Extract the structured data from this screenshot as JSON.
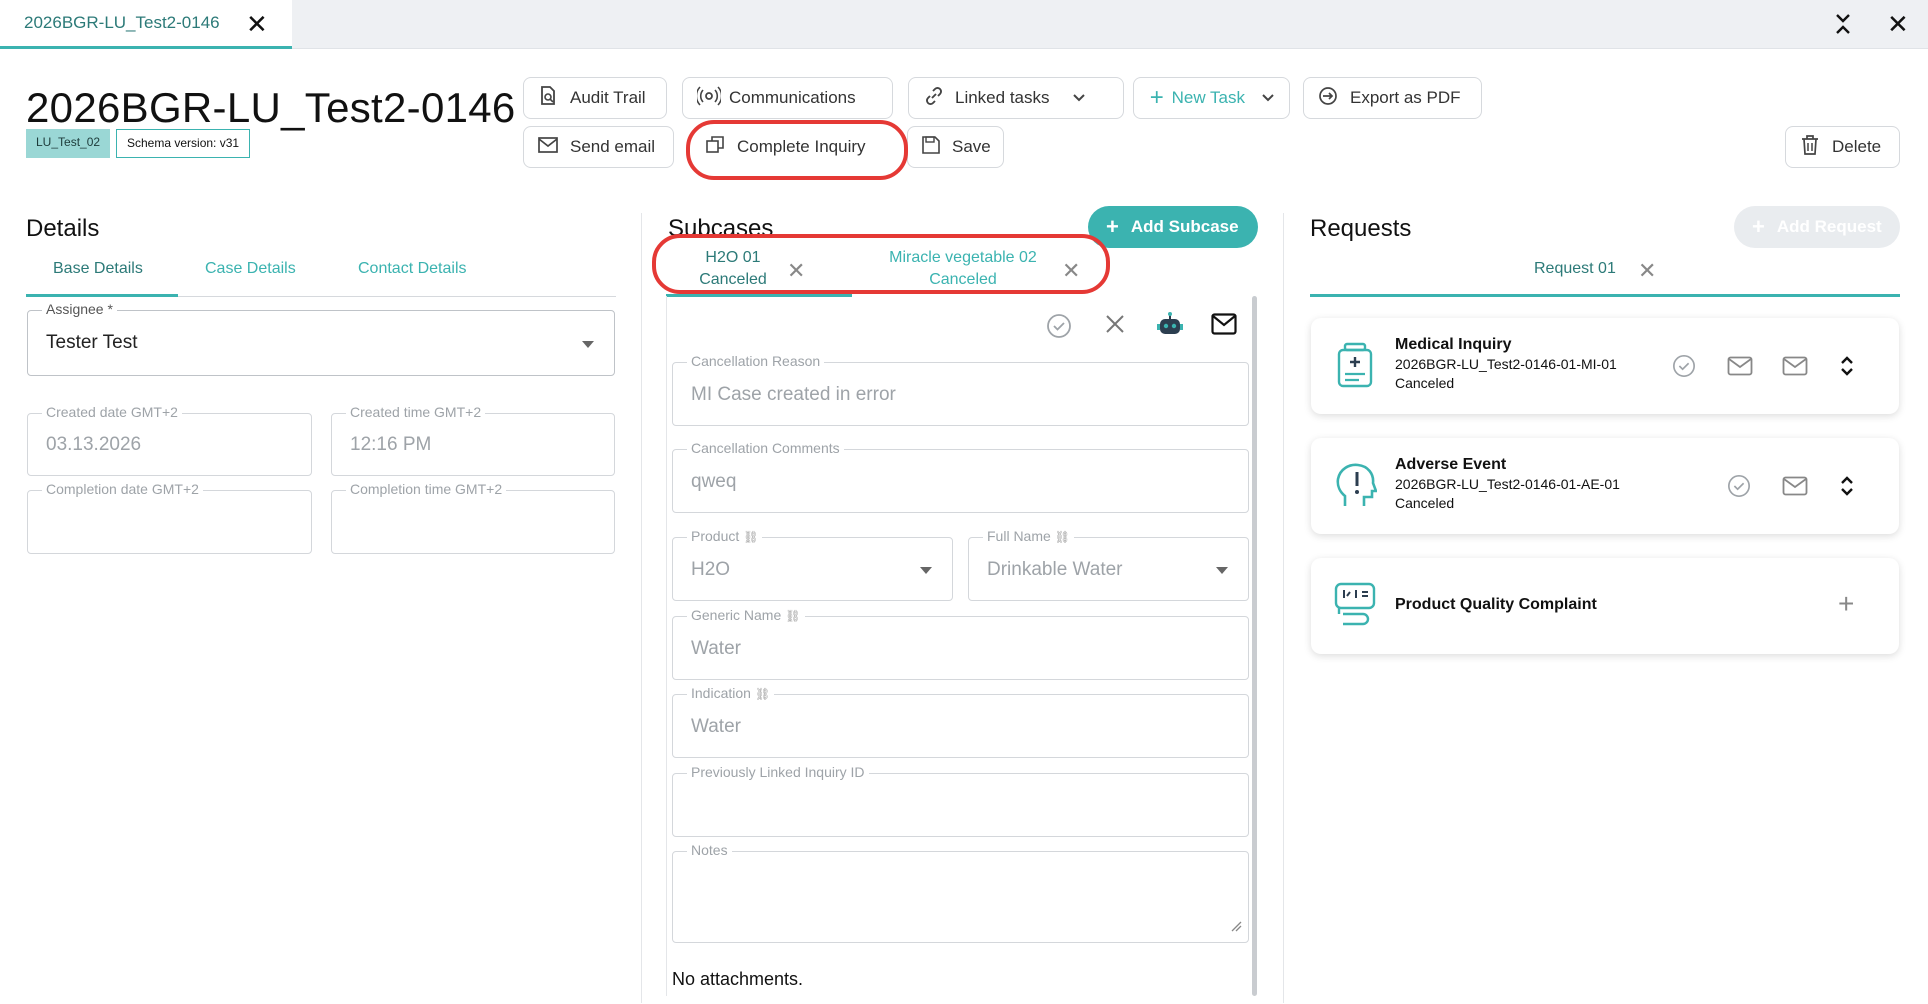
{
  "window": {
    "tab_label": "2026BGR-LU_Test2-0146",
    "title": "2026BGR-LU_Test2-0146",
    "tag_primary": "LU_Test_02",
    "tag_schema": "Schema version: v31"
  },
  "toolbar": {
    "audit_trail": "Audit Trail",
    "communications": "Communications",
    "linked_tasks": "Linked tasks",
    "new_task": "New Task",
    "export_pdf": "Export as PDF",
    "send_email": "Send email",
    "complete_inquiry": "Complete Inquiry",
    "save": "Save",
    "delete": "Delete"
  },
  "details": {
    "title": "Details",
    "tabs": [
      "Base Details",
      "Case Details",
      "Contact Details"
    ],
    "assignee_label": "Assignee *",
    "assignee_value": "Tester Test",
    "created_date_label": "Created date GMT+2",
    "created_date_value": "03.13.2026",
    "created_time_label": "Created time GMT+2",
    "created_time_value": "12:16 PM",
    "completion_date_label": "Completion date GMT+2",
    "completion_time_label": "Completion time GMT+2"
  },
  "subcases": {
    "title": "Subcases",
    "add_label": "Add Subcase",
    "tabs": [
      {
        "name": "H2O 01",
        "status": "Canceled"
      },
      {
        "name": "Miracle vegetable 02",
        "status": "Canceled"
      }
    ],
    "fields": {
      "cancellation_reason_label": "Cancellation Reason",
      "cancellation_reason_value": "MI Case created in error",
      "cancellation_comments_label": "Cancellation Comments",
      "cancellation_comments_value": "qweq",
      "product_label": "Product",
      "product_value": "H2O",
      "full_name_label": "Full Name",
      "full_name_value": "Drinkable Water",
      "generic_name_label": "Generic Name",
      "generic_name_value": "Water",
      "indication_label": "Indication",
      "indication_value": "Water",
      "linked_inquiry_label": "Previously Linked Inquiry ID",
      "notes_label": "Notes"
    },
    "attachments_text": "No attachments."
  },
  "requests": {
    "title": "Requests",
    "add_label": "Add Request",
    "tab_label": "Request 01",
    "cards": [
      {
        "title": "Medical Inquiry",
        "id": "2026BGR-LU_Test2-0146-01-MI-01",
        "status": "Canceled"
      },
      {
        "title": "Adverse Event",
        "id": "2026BGR-LU_Test2-0146-01-AE-01",
        "status": "Canceled"
      },
      {
        "title": "Product Quality Complaint"
      }
    ]
  },
  "colors": {
    "accent": "#3bb3b0",
    "highlight": "#e53935"
  }
}
